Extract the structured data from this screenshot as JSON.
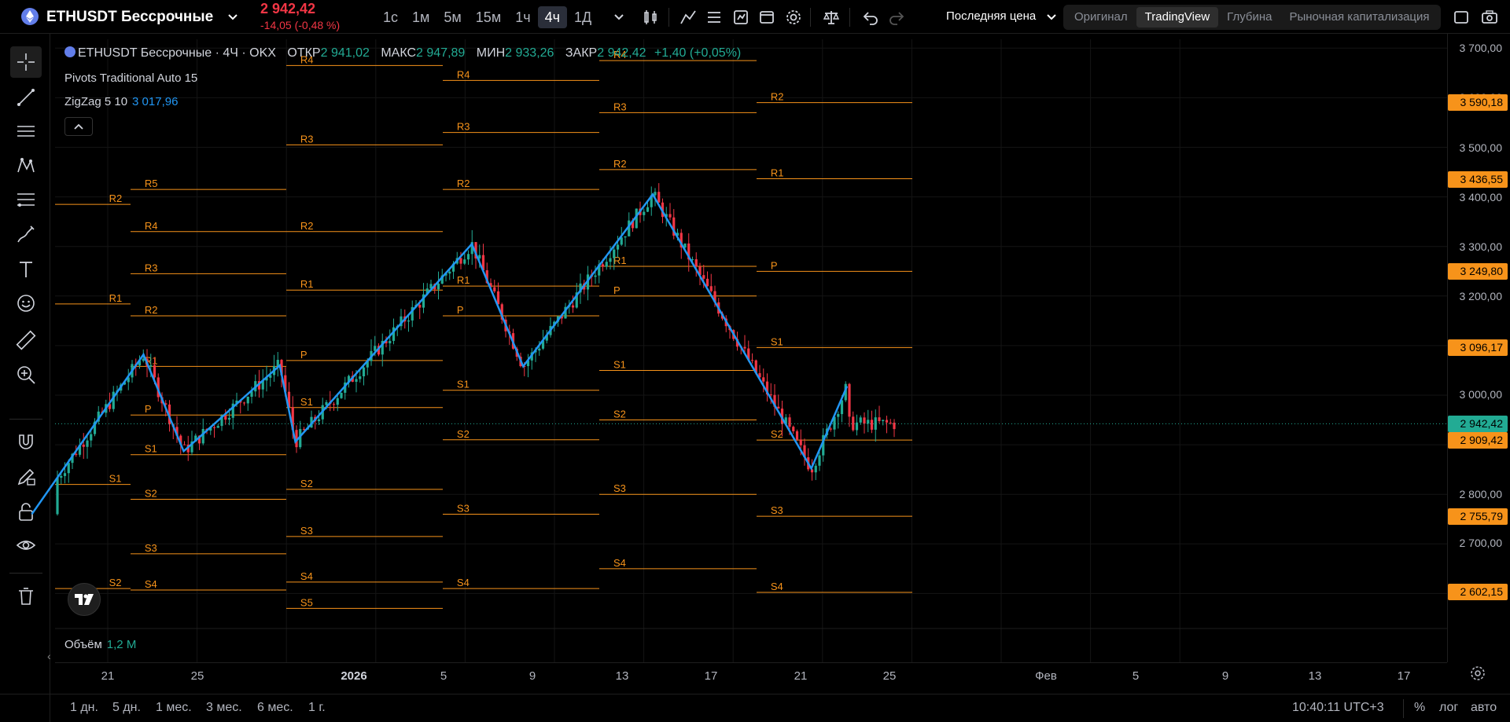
{
  "header": {
    "symbol": "ETHUSDT Бессрочные",
    "symbol_icon": "ethereum-icon",
    "price": "2 942,42",
    "change": "-14,05 (-0,48 %)",
    "intervals": [
      "1с",
      "1м",
      "5м",
      "15м",
      "1ч",
      "4ч",
      "1Д"
    ],
    "active_interval": "4ч",
    "price_source": "Последняя цена",
    "view_tabs": [
      "Оригинал",
      "TradingView",
      "Глубина",
      "Рыночная капитализация"
    ],
    "active_view": "TradingView"
  },
  "toolbar": {
    "tools": [
      "crosshair-icon",
      "trend-line-icon",
      "horizontal-lines-icon",
      "pattern-icon",
      "fib-icon",
      "brush-icon",
      "text-icon",
      "emoji-icon",
      "ruler-icon",
      "zoom-in-icon",
      "magnet-icon",
      "draw-lock-icon",
      "lock-icon",
      "eye-icon",
      "trash-icon"
    ]
  },
  "legend": {
    "title": "ETHUSDT Бессрочные · 4Ч · OKX",
    "open_label": "ОТКР",
    "open": "2 941,02",
    "high_label": "МАКС",
    "high": "2 947,89",
    "low_label": "МИН",
    "low": "2 933,26",
    "close_label": "ЗАКР",
    "close": "2 942,42",
    "change": "+1,40 (+0,05%)"
  },
  "indicators": {
    "pivots": "Pivots Traditional Auto 15",
    "zigzag": "ZigZag 5 10",
    "zigzag_value": "3 017,96",
    "volume_label": "Объём",
    "volume_value": "1,2 M"
  },
  "colors": {
    "up": "#22ab94",
    "down": "#f23645",
    "pivot": "#f7931a",
    "zigzag": "#2196f3",
    "badge": "#f7931a",
    "last_price_badge": "#22ab94"
  },
  "price_scale": {
    "labels": [
      "3 700,00",
      "3 600,00",
      "3 500,00",
      "3 400,00",
      "3 300,00",
      "3 200,00",
      "3 000,00",
      "2 800,00",
      "2 700,00"
    ],
    "badges": [
      {
        "value": "3 590,18",
        "kind": "pivot"
      },
      {
        "value": "3 436,55",
        "kind": "pivot"
      },
      {
        "value": "3 249,80",
        "kind": "pivot"
      },
      {
        "value": "3 096,17",
        "kind": "pivot"
      },
      {
        "value": "2 942,42",
        "kind": "last"
      },
      {
        "value": "2 909,42",
        "kind": "pivot"
      },
      {
        "value": "2 755,79",
        "kind": "pivot"
      },
      {
        "value": "2 602,15",
        "kind": "pivot"
      }
    ]
  },
  "chart_data": {
    "type": "candlestick",
    "y_axis_range": [
      2570,
      3720
    ],
    "pivot_periods": [
      {
        "levels": [
          {
            "name": "R2",
            "price": 3385
          },
          {
            "name": "R1",
            "price": 3184
          },
          {
            "name": "S1",
            "price": 2820
          },
          {
            "name": "S2",
            "price": 2610
          }
        ]
      },
      {
        "levels": [
          {
            "name": "R5",
            "price": 3415
          },
          {
            "name": "R4",
            "price": 3330
          },
          {
            "name": "R3",
            "price": 3245
          },
          {
            "name": "R2",
            "price": 3160
          },
          {
            "name": "R1",
            "price": 3058
          },
          {
            "name": "P",
            "price": 2960
          },
          {
            "name": "S1",
            "price": 2880
          },
          {
            "name": "S2",
            "price": 2790
          },
          {
            "name": "S3",
            "price": 2680
          },
          {
            "name": "S4",
            "price": 2607
          }
        ]
      },
      {
        "levels": [
          {
            "name": "R4",
            "price": 3665
          },
          {
            "name": "R3",
            "price": 3505
          },
          {
            "name": "R2",
            "price": 3330
          },
          {
            "name": "R1",
            "price": 3212
          },
          {
            "name": "P",
            "price": 3070
          },
          {
            "name": "S1",
            "price": 2975
          },
          {
            "name": "S2",
            "price": 2810
          },
          {
            "name": "S3",
            "price": 2715
          },
          {
            "name": "S4",
            "price": 2623
          },
          {
            "name": "S5",
            "price": 2570
          }
        ]
      },
      {
        "levels": [
          {
            "name": "R4",
            "price": 3635
          },
          {
            "name": "R3",
            "price": 3530
          },
          {
            "name": "R2",
            "price": 3415
          },
          {
            "name": "R1",
            "price": 3220
          },
          {
            "name": "P",
            "price": 3160
          },
          {
            "name": "S1",
            "price": 3010
          },
          {
            "name": "S2",
            "price": 2910
          },
          {
            "name": "S3",
            "price": 2760
          },
          {
            "name": "S4",
            "price": 2610
          }
        ]
      },
      {
        "levels": [
          {
            "name": "R2",
            "price": 3590.18
          },
          {
            "name": "R1",
            "price": 3436.55
          },
          {
            "name": "P",
            "price": 3249.8
          },
          {
            "name": "S1",
            "price": 3096.17
          },
          {
            "name": "S2",
            "price": 2909.42
          },
          {
            "name": "S3",
            "price": 2755.79
          },
          {
            "name": "S4",
            "price": 2602.15
          }
        ]
      }
    ],
    "zigzag": [
      {
        "date": "Dec 18",
        "price": 2760
      },
      {
        "date": "Dec 23",
        "price": 3082
      },
      {
        "date": "Dec 25",
        "price": 2887
      },
      {
        "date": "Dec 29",
        "price": 3060
      },
      {
        "date": "Dec 30",
        "price": 2906
      },
      {
        "date": "Jan 6",
        "price": 3305
      },
      {
        "date": "Jan 8",
        "price": 3058
      },
      {
        "date": "Jan 14",
        "price": 3405
      },
      {
        "date": "Jan 21",
        "price": 2852
      },
      {
        "date": "Jan 23",
        "price": 3017.96
      }
    ],
    "last_price": 2942.42
  },
  "time_axis": {
    "labels": [
      "21",
      "25",
      "2026",
      "5",
      "9",
      "13",
      "17",
      "21",
      "25",
      "Фев",
      "5",
      "9",
      "13",
      "17"
    ],
    "bold": "2026"
  },
  "bottom": {
    "ranges": [
      "1 дн.",
      "5 дн.",
      "1 мес.",
      "3 мес.",
      "6 мес.",
      "1 г."
    ],
    "clock": "10:40:11 UTC+3",
    "percent": "%",
    "log": "лог",
    "auto": "авто"
  }
}
